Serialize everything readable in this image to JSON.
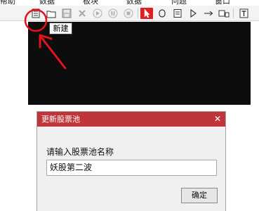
{
  "menu": {
    "items": [
      "帮助",
      "数据",
      "板块",
      "数据",
      "问题",
      "窗口"
    ]
  },
  "toolbar": {
    "buttons": [
      {
        "icon": "new-document-icon"
      },
      {
        "icon": "open-folder-icon"
      },
      {
        "icon": "save-icon"
      },
      {
        "icon": "delete-icon"
      },
      {
        "icon": "play-icon"
      },
      {
        "icon": "pause-icon"
      },
      {
        "icon": "stop-icon"
      },
      {
        "icon": "select-pointer-icon",
        "active": true
      },
      {
        "icon": "ellipse-icon"
      },
      {
        "icon": "document-icon"
      },
      {
        "icon": "triangle-right-icon"
      },
      {
        "icon": "arrow-right-icon"
      },
      {
        "icon": "window-layout-icon"
      },
      {
        "icon": "text-tool-icon"
      }
    ]
  },
  "tooltip": {
    "text": "新建"
  },
  "dialog": {
    "title": "更新股票池",
    "close_glyph": "✕",
    "prompt": "请输入股票池名称",
    "input_value": "妖股第二波",
    "ok_label": "确定"
  },
  "colors": {
    "accent": "#e02020",
    "dialog_title_bg": "#c0353a",
    "canvas_bg": "#0d0d0d",
    "annotation": "#e8101c"
  }
}
